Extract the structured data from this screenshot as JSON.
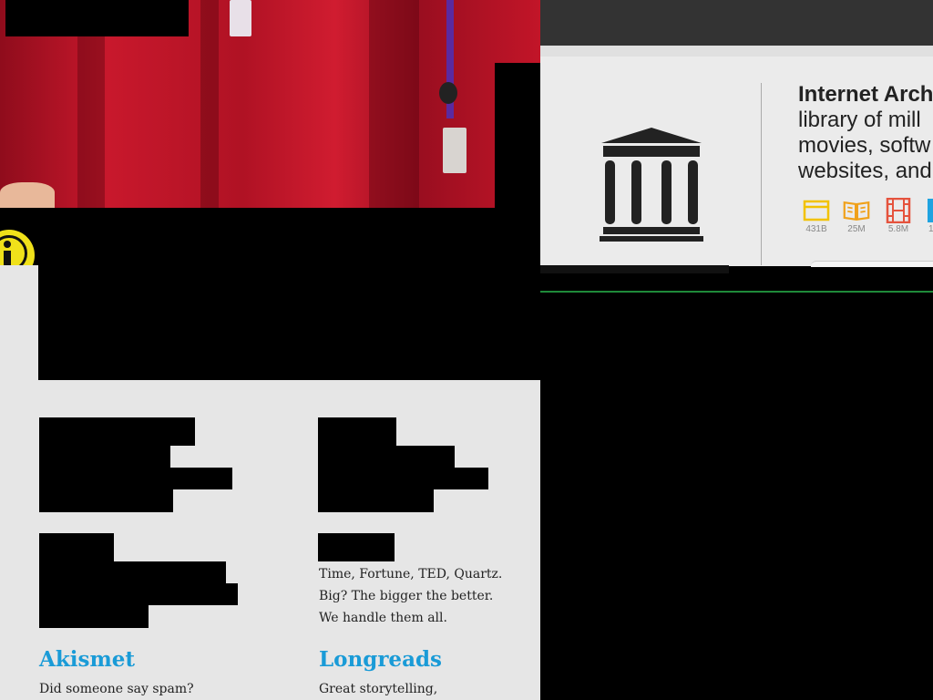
{
  "internet_archive": {
    "title": "Internet Arch",
    "subtitle": "library of mill\nmovies, softw\nwebsites, and",
    "icons": [
      {
        "name": "web-icon",
        "color": "#f2c200",
        "count": "431B"
      },
      {
        "name": "book-icon",
        "color": "#f0a11a",
        "count": "25M"
      },
      {
        "name": "film-icon",
        "color": "#e5533d",
        "count": "5.8M"
      },
      {
        "name": "audio-icon",
        "color": "#1fa3e0",
        "count": "1"
      }
    ]
  },
  "products": {
    "vip_description": "Time, Fortune, TED, Quartz.\nBig? The bigger the better.\nWe handle them all.",
    "items": [
      {
        "name": "Akismet",
        "description": "Did someone say spam?"
      },
      {
        "name": "Longreads",
        "description": "Great storytelling,"
      }
    ]
  },
  "colors": {
    "link": "#1a9bd7",
    "panel_bg": "#e6e6e6",
    "accessibility_yellow": "#f0e11a"
  }
}
